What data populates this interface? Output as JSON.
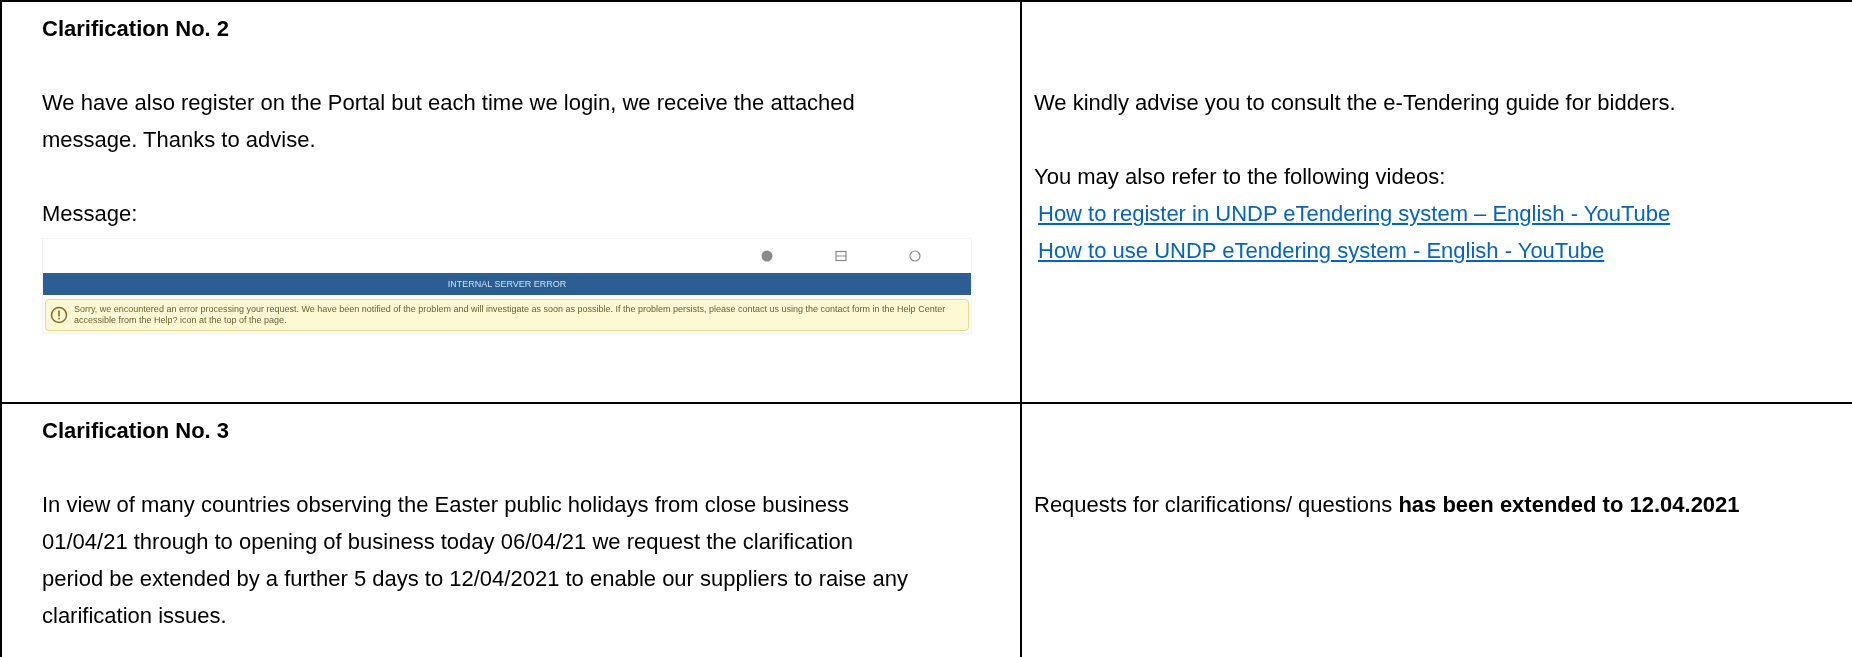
{
  "clarifications": [
    {
      "heading": "Clarification No. 2",
      "question": "We have also register on the Portal but each time we login, we receive the attached message.  Thanks to advise.",
      "message_label": "Message:",
      "screenshot": {
        "banner": "INTERNAL SERVER ERROR",
        "alert": "Sorry, we encountered an error processing your request. We have been notified of the problem and will investigate as soon as possible. If the problem persists, please contact us using the contact form in the Help Center accessible from the Help? icon at the top of the page."
      },
      "answer": {
        "paragraphs": [
          "We kindly advise you to consult the e-Tendering guide for bidders.",
          "You may also refer to the following videos:"
        ],
        "links": [
          "How to register in UNDP eTendering system – English - YouTube",
          "How to use UNDP eTendering system - English - YouTube"
        ]
      }
    },
    {
      "heading": "Clarification No. 3",
      "question": "In view of many countries observing the Easter public holidays from close business 01/04/21 through to opening of business today 06/04/21 we request the clarification period be extended by a further 5 days to 12/04/2021 to enable our suppliers to raise any clarification issues.",
      "answer": {
        "paragraphs": [
          "Requests for clarifications/ questions **has been extended to 12.04.2021**"
        ]
      }
    }
  ]
}
